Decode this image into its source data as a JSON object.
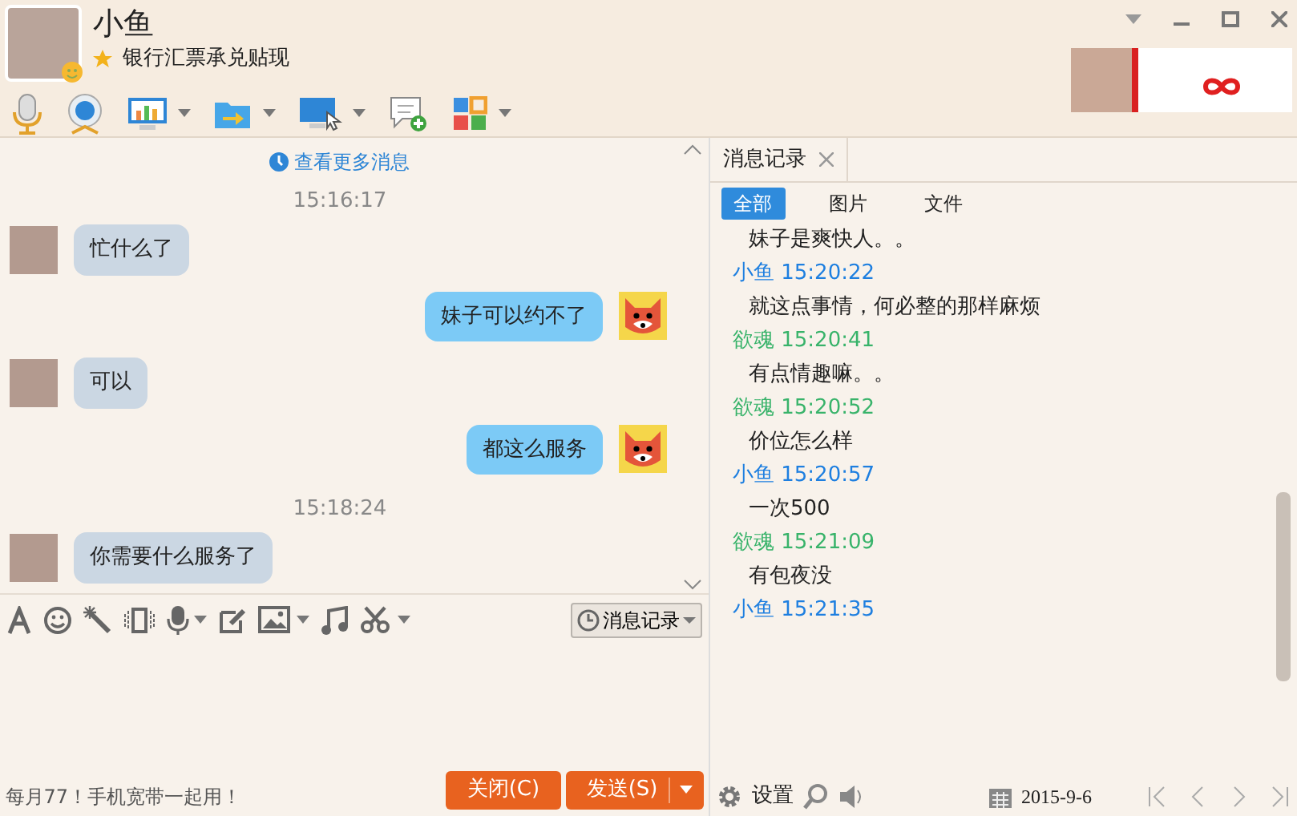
{
  "contact": {
    "name": "小鱼",
    "signature": "银行汇票承兑贴现"
  },
  "toolbar": [
    {
      "kind": "mic",
      "dropdown": false
    },
    {
      "kind": "webcam",
      "dropdown": false
    },
    {
      "kind": "screen",
      "dropdown": true
    },
    {
      "kind": "file",
      "dropdown": true
    },
    {
      "kind": "remote",
      "dropdown": true
    },
    {
      "kind": "addchat",
      "dropdown": false
    },
    {
      "kind": "apps",
      "dropdown": true
    }
  ],
  "chat": {
    "more_link": "查看更多消息",
    "messages": [
      {
        "kind": "time",
        "text": "15:16:17"
      },
      {
        "kind": "in",
        "text": "忙什么了"
      },
      {
        "kind": "out",
        "text": "妹子可以约不了"
      },
      {
        "kind": "in",
        "text": "可以"
      },
      {
        "kind": "out",
        "text": "都这么服务"
      },
      {
        "kind": "time",
        "text": "15:18:24"
      },
      {
        "kind": "in",
        "text": "你需要什么服务了"
      }
    ]
  },
  "input_toolbar": [
    {
      "kind": "font",
      "dropdown": false
    },
    {
      "kind": "smiley",
      "dropdown": false
    },
    {
      "kind": "wand",
      "dropdown": false
    },
    {
      "kind": "vibrate",
      "dropdown": false
    },
    {
      "kind": "mic",
      "dropdown": true
    },
    {
      "kind": "edit",
      "dropdown": false
    },
    {
      "kind": "image",
      "dropdown": true
    },
    {
      "kind": "music",
      "dropdown": false
    },
    {
      "kind": "scissors",
      "dropdown": true
    }
  ],
  "history_button": "消息记录",
  "footer": {
    "ad": "每月77！手机宽带一起用！",
    "buttons": [
      {
        "kind": "close",
        "label": "关闭(C)"
      },
      {
        "kind": "send",
        "label": "发送(S)"
      }
    ]
  },
  "history": {
    "tab": "消息记录",
    "filters": [
      {
        "label": "全部",
        "selected": true
      },
      {
        "label": "图片",
        "selected": false
      },
      {
        "label": "文件",
        "selected": false
      }
    ],
    "entries": [
      {
        "text": "妹子是爽快人。。"
      },
      {
        "sender": "小鱼",
        "time": "15:20:22",
        "color": "#1e7fe0",
        "text": "就这点事情，何必整的那样麻烦"
      },
      {
        "sender": "欲魂",
        "time": "15:20:41",
        "color": "#38b36a",
        "text": "有点情趣嘛。。"
      },
      {
        "sender": "欲魂",
        "time": "15:20:52",
        "color": "#38b36a",
        "text": "价位怎么样"
      },
      {
        "sender": "小鱼",
        "time": "15:20:57",
        "color": "#1e7fe0",
        "text": "一次500"
      },
      {
        "sender": "欲魂",
        "time": "15:21:09",
        "color": "#38b36a",
        "text": "有包夜没"
      },
      {
        "sender": "小鱼",
        "time": "15:21:35",
        "color": "#1e7fe0"
      }
    ],
    "settings": "设置",
    "date": "2015-9-6"
  }
}
